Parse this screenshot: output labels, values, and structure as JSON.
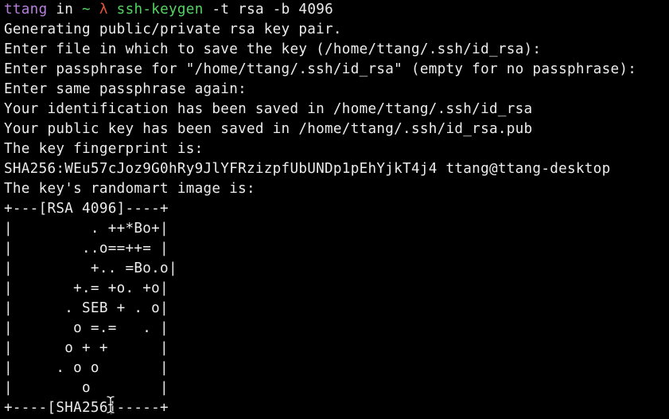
{
  "prompt": {
    "user": "ttang",
    "in": " in ",
    "dir": "~",
    "symbol": "λ",
    "command": "ssh-keygen",
    "args": " -t rsa -b 4096"
  },
  "output": [
    "Generating public/private rsa key pair.",
    "Enter file in which to save the key (/home/ttang/.ssh/id_rsa):",
    "Enter passphrase for \"/home/ttang/.ssh/id_rsa\" (empty for no passphrase):",
    "Enter same passphrase again:",
    "Your identification has been saved in /home/ttang/.ssh/id_rsa",
    "Your public key has been saved in /home/ttang/.ssh/id_rsa.pub",
    "The key fingerprint is:",
    "SHA256:WEu57cJoz9G0hRy9JlYFRzizpfUbUNDp1pEhYjkT4j4 ttang@ttang-desktop",
    "The key's randomart image is:"
  ],
  "randomart": [
    "+---[RSA 4096]----+",
    "|         . ++*Bo+|",
    "|        ..o==++= |",
    "|         +.. =Bo.o|",
    "|       +.= +o. +o|",
    "|      . SEB + . o|",
    "|       o =.=   . |",
    "|      o + +      |",
    "|     . o o       |",
    "|        o        |",
    "+----[SHA256]-----+"
  ],
  "colors": {
    "background": "#000000",
    "text": "#ececec",
    "user": "#b77ee0",
    "command": "#56d364",
    "lambda": "#e5533d"
  },
  "cursor_icon": "ibeam-cursor-icon"
}
